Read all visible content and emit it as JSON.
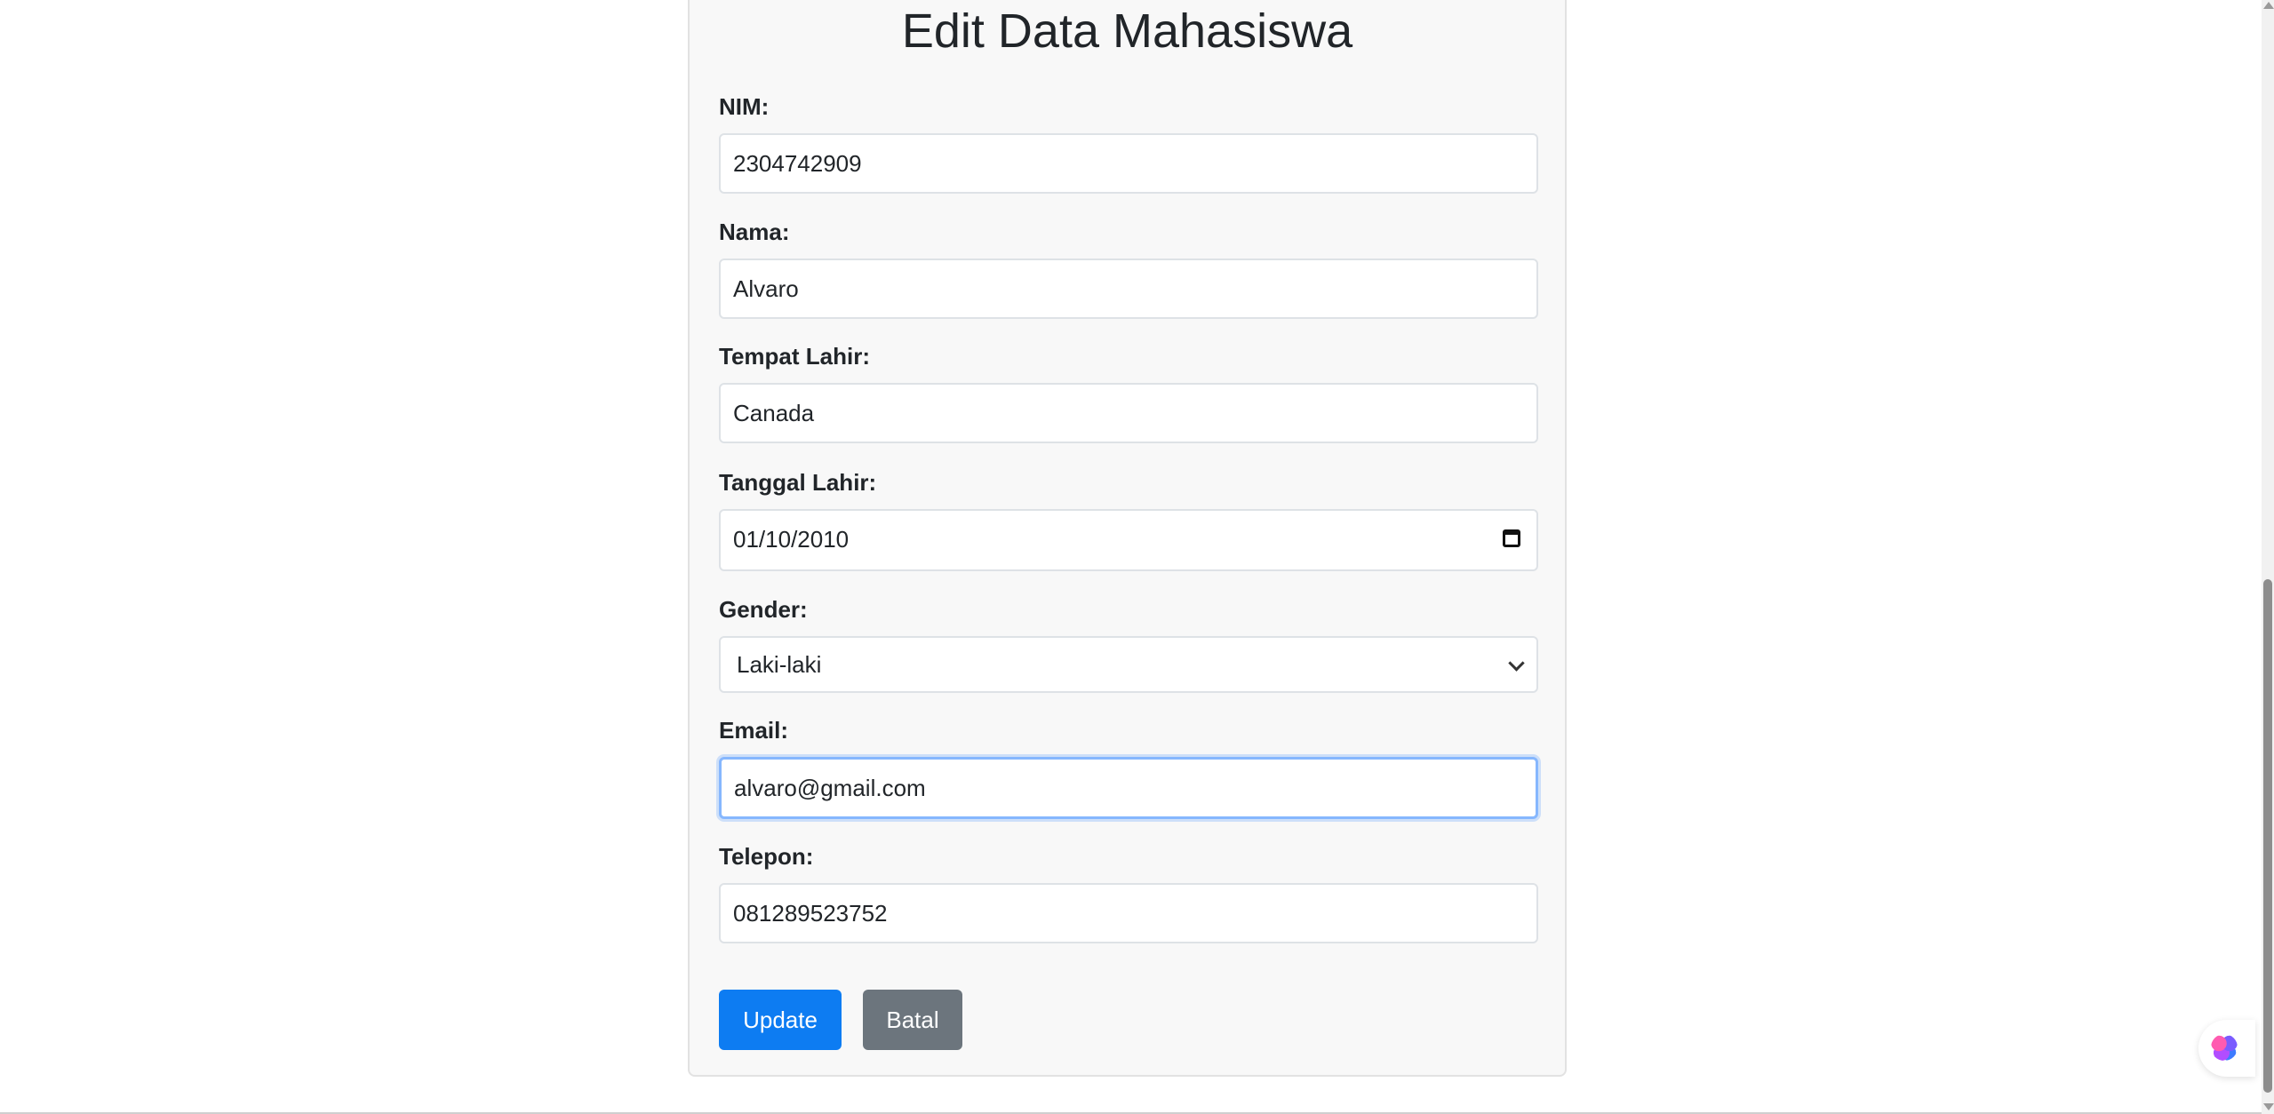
{
  "form": {
    "title": "Edit Data Mahasiswa",
    "fields": [
      {
        "label": "NIM:",
        "value": "2304742909"
      },
      {
        "label": "Nama:",
        "value": "Alvaro"
      },
      {
        "label": "Tempat Lahir:",
        "value": "Canada"
      },
      {
        "label": "Tanggal Lahir:",
        "value": "01/10/2010"
      },
      {
        "label": "Gender:",
        "value": "Laki-laki"
      },
      {
        "label": "Email:",
        "value": "alvaro@gmail.com"
      },
      {
        "label": "Telepon:",
        "value": "081289523752"
      }
    ],
    "buttons": {
      "update_label": "Update",
      "batal_label": "Batal"
    }
  },
  "colors": {
    "primary": "#0d7cf2",
    "secondary": "#6c757d",
    "focus_border": "#86b7fe",
    "card_background": "#f8f8f8"
  },
  "icons": {
    "date_picker": "calendar-icon",
    "select": "chevron-down-icon",
    "floating_widget": "brain-icon"
  }
}
